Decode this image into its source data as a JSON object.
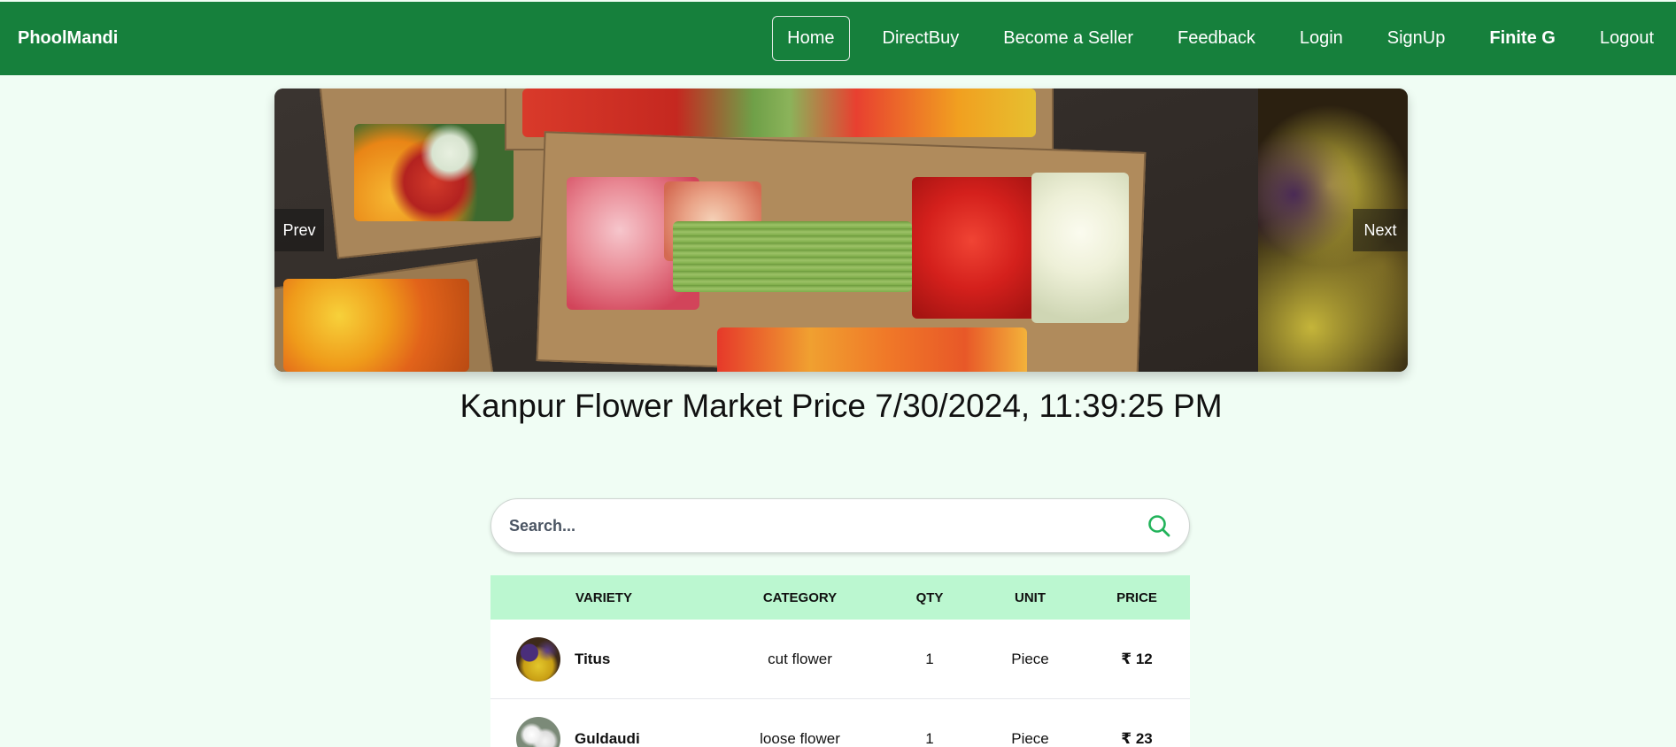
{
  "navbar": {
    "brand": "PhoolMandi",
    "links": [
      {
        "label": "Home",
        "active": true
      },
      {
        "label": "DirectBuy"
      },
      {
        "label": "Become a Seller"
      },
      {
        "label": "Feedback"
      },
      {
        "label": "Login"
      },
      {
        "label": "SignUp"
      },
      {
        "label": "Finite G"
      },
      {
        "label": "Logout"
      }
    ],
    "color": "#16803c"
  },
  "carousel": {
    "prev_label": "Prev",
    "next_label": "Next"
  },
  "market_title": "Kanpur Flower Market Price 7/30/2024, 11:39:25 PM",
  "search": {
    "placeholder": "Search...",
    "value": "",
    "icon": "search-icon"
  },
  "table": {
    "headers": {
      "variety": "VARIETY",
      "category": "CATEGORY",
      "qty": "QTY",
      "unit": "UNIT",
      "price": "PRICE"
    },
    "rows": [
      {
        "variety": "Titus",
        "category": "cut flower",
        "qty": "1",
        "unit": "Piece",
        "price": "₹ 12"
      },
      {
        "variety": "Guldaudi",
        "category": "loose flower",
        "qty": "1",
        "unit": "Piece",
        "price": "₹ 23"
      }
    ],
    "header_bg": "#bbf7d0"
  },
  "page_bg": "#f0fdf4"
}
